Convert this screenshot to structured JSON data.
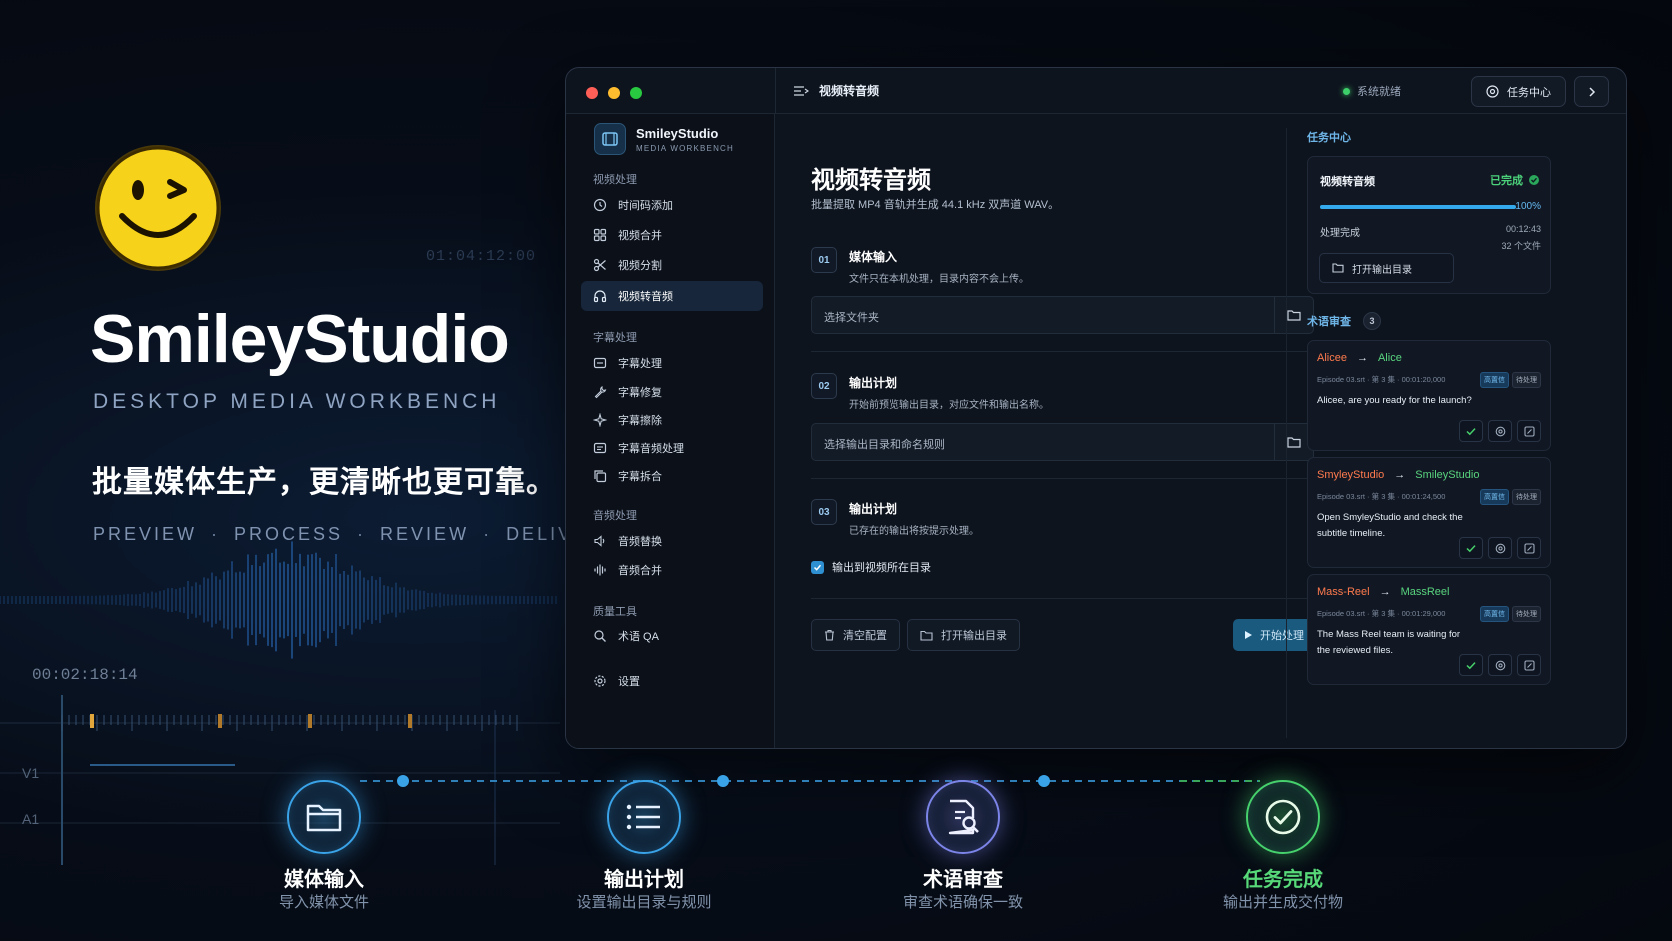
{
  "hero": {
    "bg_timecode": "01:04:12:00",
    "title": "SmileyStudio",
    "subtitle": "DESKTOP MEDIA WORKBENCH",
    "tagline": "批量媒体生产，更清晰也更可靠。",
    "steps": [
      "PREVIEW",
      "PROCESS",
      "REVIEW",
      "DELIVER"
    ],
    "timecode": "00:02:18:14",
    "track_v": "V1",
    "track_a": "A1"
  },
  "app": {
    "brand_name": "SmileyStudio",
    "brand_sub": "MEDIA WORKBENCH",
    "toolbar_title": "视频转音频",
    "status": "系统就绪",
    "task_center_button": "任务中心",
    "nav": {
      "group_video": "视频处理",
      "video_items": [
        "时间码添加",
        "视频合并",
        "视频分割",
        "视频转音频"
      ],
      "group_subtitle": "字幕处理",
      "subtitle_items": [
        "字幕处理",
        "字幕修复",
        "字幕擦除",
        "字幕音频处理",
        "字幕拆合"
      ],
      "group_audio": "音频处理",
      "audio_items": [
        "音频替换",
        "音频合并"
      ],
      "group_quality": "质量工具",
      "quality_items": [
        "术语 QA"
      ],
      "settings": "设置"
    },
    "main": {
      "title": "视频转音频",
      "subtitle": "批量提取 MP4 音轨并生成 44.1 kHz 双声道 WAV。",
      "steps": [
        {
          "num": "01",
          "title": "媒体输入",
          "desc": "文件只在本机处理，目录内容不会上传。",
          "field": "选择文件夹"
        },
        {
          "num": "02",
          "title": "输出计划",
          "desc": "开始前预览输出目录，对应文件和输出名称。",
          "field": "选择输出目录和命名规则"
        },
        {
          "num": "03",
          "title": "输出计划",
          "desc": "已存在的输出将按提示处理。"
        }
      ],
      "checkbox_label": "输出到视频所在目录",
      "clear_button": "清空配置",
      "open_output_button": "打开输出目录",
      "start_button": "开始处理"
    },
    "right": {
      "task_center_title": "任务中心",
      "task": {
        "name": "视频转音频",
        "state": "已完成",
        "progress": 100,
        "progress_label": "100%",
        "status": "处理完成",
        "duration": "00:12:43",
        "files": "32 个文件",
        "open_button": "打开输出目录"
      },
      "qa_title": "术语审查",
      "qa_count": "3",
      "qa_items": [
        {
          "from": "Alicee",
          "to": "Alice",
          "meta": "Episode 03.srt · 第 3 集 · 00:01:20,000",
          "tag_high": "高置信",
          "tag_pending": "待处理",
          "text_lines": [
            "Alicee, are you ready for the launch?"
          ]
        },
        {
          "from": "SmyleyStudio",
          "to": "SmileyStudio",
          "meta": "Episode 03.srt · 第 3 集 · 00:01:24,500",
          "tag_high": "高置信",
          "tag_pending": "待处理",
          "text_lines": [
            "Open SmyleyStudio and check the",
            "subtitle timeline."
          ]
        },
        {
          "from": "Mass-Reel",
          "to": "MassReel",
          "meta": "Episode 03.srt · 第 3 集 · 00:01:29,000",
          "tag_high": "高置信",
          "tag_pending": "待处理",
          "text_lines": [
            "The Mass Reel team is waiting for",
            "the reviewed files."
          ]
        }
      ]
    }
  },
  "pipeline": [
    {
      "title": "媒体输入",
      "sub": "导入媒体文件",
      "color": "#3aa3e8"
    },
    {
      "title": "输出计划",
      "sub": "设置输出目录与规则",
      "color": "#3aa3e8"
    },
    {
      "title": "术语审查",
      "sub": "审查术语确保一致",
      "color": "#7c84e8"
    },
    {
      "title": "任务完成",
      "sub": "输出并生成交付物",
      "color": "#46d16c"
    }
  ],
  "colors": {
    "accent": "#34a9ec",
    "success": "#46d16c",
    "warning": "#ff7a4d",
    "smiley_yellow": "#f7d21a"
  }
}
